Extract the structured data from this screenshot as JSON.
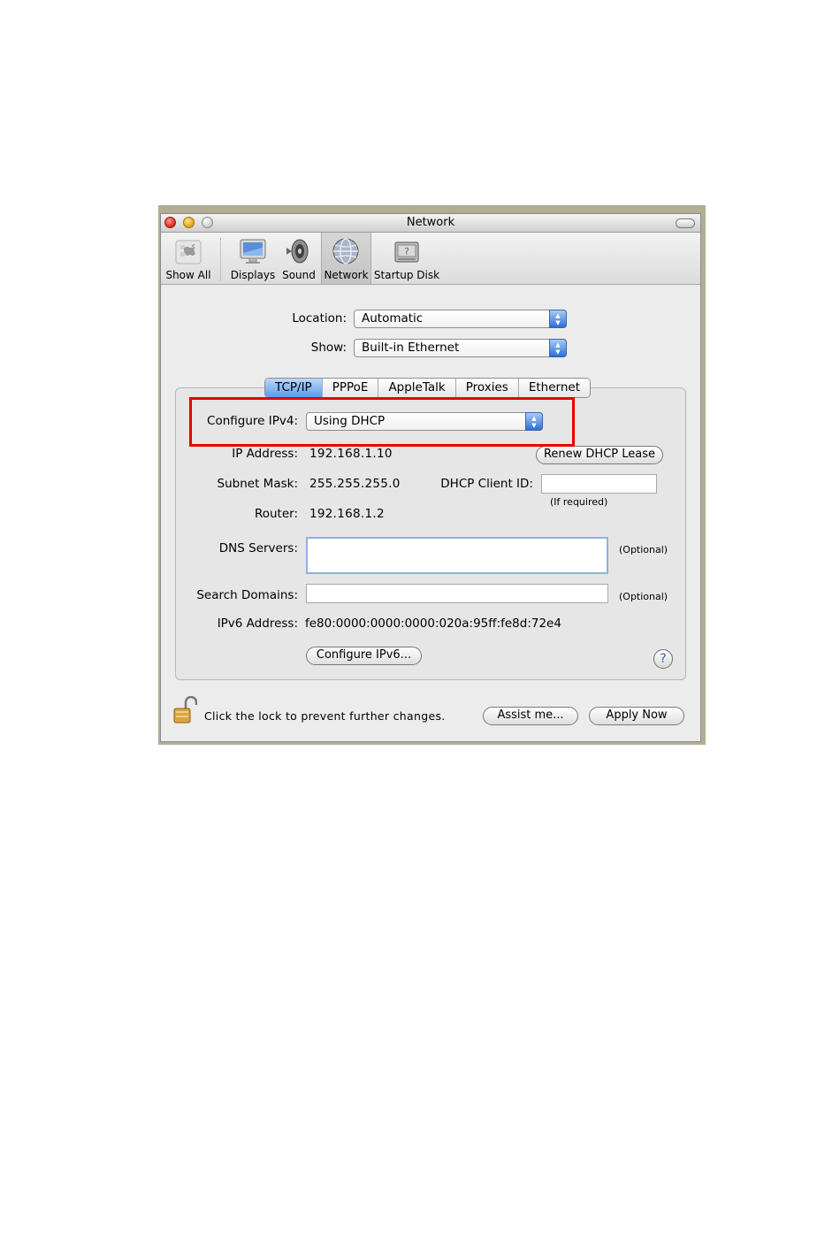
{
  "window": {
    "title": "Network"
  },
  "toolbar": {
    "items": [
      {
        "label": "Show All",
        "icon": "apple-icon"
      },
      {
        "label": "Displays",
        "icon": "display-icon"
      },
      {
        "label": "Sound",
        "icon": "speaker-icon"
      },
      {
        "label": "Network",
        "icon": "globe-icon",
        "selected": true
      },
      {
        "label": "Startup Disk",
        "icon": "disk-icon"
      }
    ]
  },
  "location": {
    "label": "Location:",
    "value": "Automatic"
  },
  "show": {
    "label": "Show:",
    "value": "Built-in Ethernet"
  },
  "tabs": [
    {
      "label": "TCP/IP",
      "selected": true
    },
    {
      "label": "PPPoE"
    },
    {
      "label": "AppleTalk"
    },
    {
      "label": "Proxies"
    },
    {
      "label": "Ethernet"
    }
  ],
  "tcpip": {
    "configure_label": "Configure IPv4:",
    "configure_value": "Using DHCP",
    "ip_label": "IP Address:",
    "ip_value": "192.168.1.10",
    "renew_button": "Renew DHCP Lease",
    "subnet_label": "Subnet Mask:",
    "subnet_value": "255.255.255.0",
    "client_id_label": "DHCP Client ID:",
    "client_id_value": "",
    "if_required": "(If required)",
    "router_label": "Router:",
    "router_value": "192.168.1.2",
    "dns_label": "DNS Servers:",
    "dns_value": "",
    "optional_1": "(Optional)",
    "search_label": "Search Domains:",
    "search_value": "",
    "optional_2": "(Optional)",
    "ipv6_label": "IPv6 Address:",
    "ipv6_value": "fe80:0000:0000:0000:020a:95ff:fe8d:72e4",
    "configure_ipv6_button": "Configure IPv6...",
    "help_symbol": "?"
  },
  "footer": {
    "lock_text": "Click the lock to prevent further changes.",
    "assist_button": "Assist me...",
    "apply_button": "Apply Now"
  },
  "colors": {
    "highlight_box": "#e60000",
    "accent": "#2a6fd6"
  }
}
